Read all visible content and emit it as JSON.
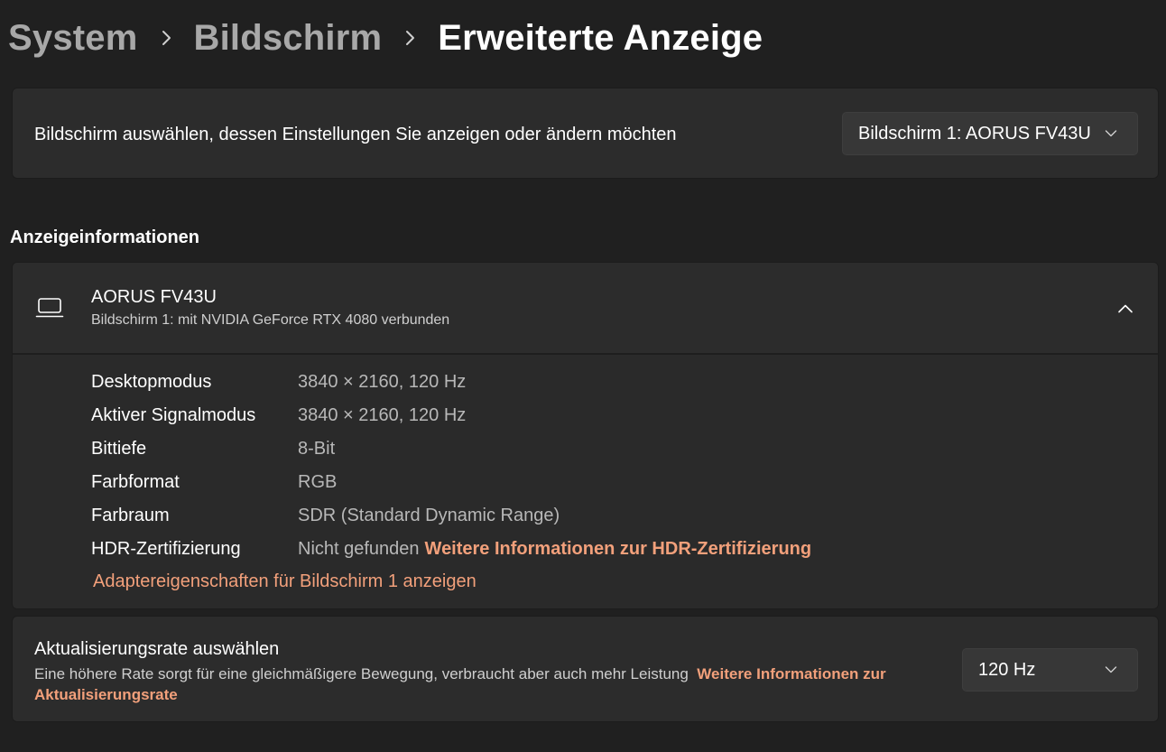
{
  "breadcrumb": {
    "items": [
      "System",
      "Bildschirm"
    ],
    "current": "Erweiterte Anzeige"
  },
  "select_display": {
    "label": "Bildschirm auswählen, dessen Einstellungen Sie anzeigen oder ändern möchten",
    "selected": "Bildschirm 1: AORUS FV43U"
  },
  "display_info": {
    "section_title": "Anzeigeinformationen",
    "name": "AORUS FV43U",
    "subtitle": "Bildschirm 1: mit NVIDIA GeForce RTX 4080 verbunden",
    "expanded": true,
    "rows": [
      {
        "label": "Desktopmodus",
        "value": "3840 × 2160, 120 Hz"
      },
      {
        "label": "Aktiver Signalmodus",
        "value": "3840 × 2160, 120 Hz"
      },
      {
        "label": "Bittiefe",
        "value": "8-Bit"
      },
      {
        "label": "Farbformat",
        "value": "RGB"
      },
      {
        "label": "Farbraum",
        "value": "SDR (Standard Dynamic Range)"
      },
      {
        "label": "HDR-Zertifizierung",
        "value": "Nicht gefunden",
        "link": "Weitere Informationen zur HDR-Zertifizierung"
      }
    ],
    "adapter_link": "Adaptereigenschaften für Bildschirm 1 anzeigen"
  },
  "refresh_rate": {
    "title": "Aktualisierungsrate auswählen",
    "description": "Eine höhere Rate sorgt für eine gleichmäßigere Bewegung, verbraucht aber auch mehr Leistung",
    "link": "Weitere Informationen zur Aktualisierungsrate",
    "selected": "120 Hz"
  },
  "icons": {
    "breadcrumb_separator": "chevron-right-icon",
    "display": "laptop-icon",
    "collapse": "chevron-up-icon",
    "dropdown": "chevron-down-icon"
  },
  "colors": {
    "background": "#202020",
    "card": "#2c2c2c",
    "accent_link": "#f2a07b",
    "breadcrumb_inactive": "#a8a8a8"
  }
}
